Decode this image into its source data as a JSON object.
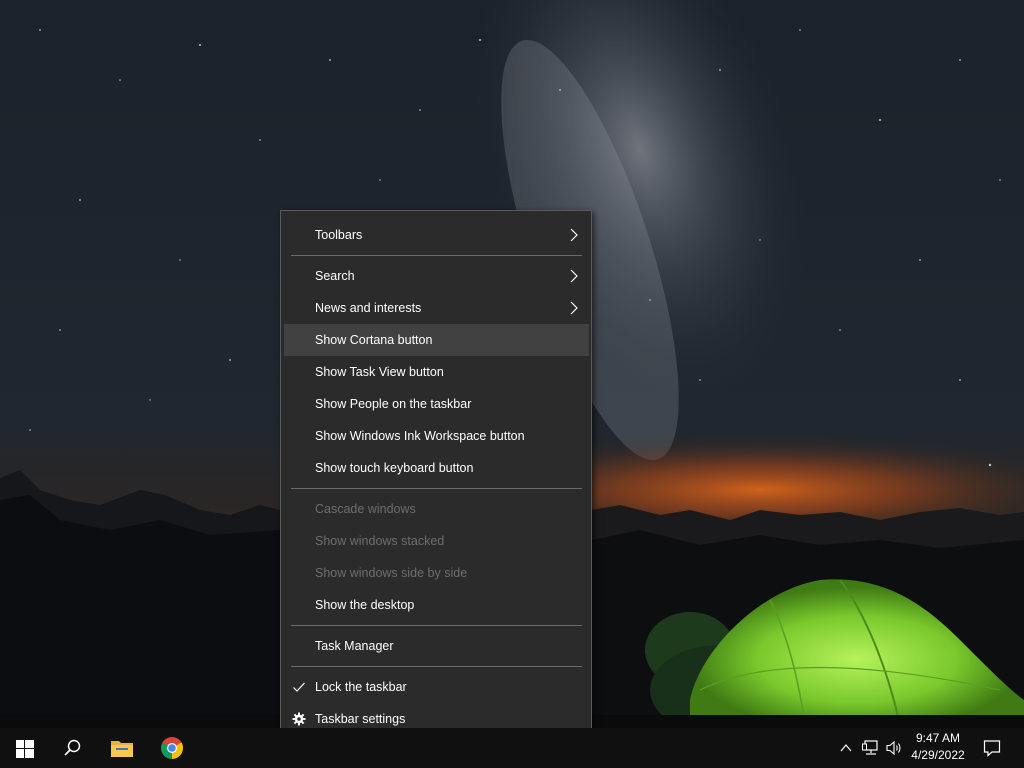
{
  "context_menu": {
    "items": [
      {
        "label": "Toolbars",
        "submenu": true,
        "state": "normal"
      },
      {
        "label": "Search",
        "submenu": true,
        "state": "normal"
      },
      {
        "label": "News and interests",
        "submenu": true,
        "state": "normal"
      },
      {
        "label": "Show Cortana button",
        "submenu": false,
        "state": "highlighted"
      },
      {
        "label": "Show Task View button",
        "submenu": false,
        "state": "normal"
      },
      {
        "label": "Show People on the taskbar",
        "submenu": false,
        "state": "normal"
      },
      {
        "label": "Show Windows Ink Workspace button",
        "submenu": false,
        "state": "normal"
      },
      {
        "label": "Show touch keyboard button",
        "submenu": false,
        "state": "normal"
      },
      {
        "label": "Cascade windows",
        "submenu": false,
        "state": "disabled"
      },
      {
        "label": "Show windows stacked",
        "submenu": false,
        "state": "disabled"
      },
      {
        "label": "Show windows side by side",
        "submenu": false,
        "state": "disabled"
      },
      {
        "label": "Show the desktop",
        "submenu": false,
        "state": "normal"
      },
      {
        "label": "Task Manager",
        "submenu": false,
        "state": "normal"
      },
      {
        "label": "Lock the taskbar",
        "submenu": false,
        "state": "checked",
        "icon": "checkmark-icon"
      },
      {
        "label": "Taskbar settings",
        "submenu": false,
        "state": "normal",
        "icon": "gear-icon"
      }
    ]
  },
  "taskbar": {
    "pinned": [
      {
        "name": "start",
        "icon": "windows-logo-icon"
      },
      {
        "name": "search",
        "icon": "search-icon"
      },
      {
        "name": "file-explorer",
        "icon": "folder-icon"
      },
      {
        "name": "chrome",
        "icon": "chrome-icon"
      }
    ],
    "tray": {
      "icons": [
        "chevron-up-icon",
        "network-icon",
        "volume-icon"
      ],
      "time": "9:47 AM",
      "date": "4/29/2022",
      "notification_icon": "action-center-icon"
    }
  },
  "colors": {
    "menu_bg": "#2b2b2b",
    "menu_highlight": "#414141",
    "menu_disabled_text": "#6d6d6d",
    "taskbar_bg": "#101010",
    "tent": "#8fe03a"
  }
}
